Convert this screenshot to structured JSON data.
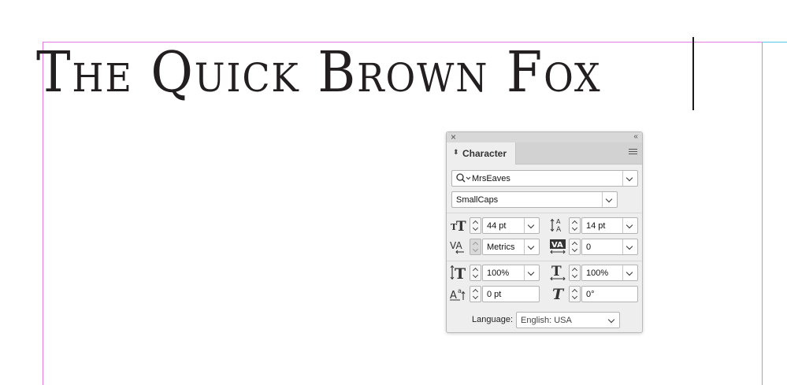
{
  "canvas": {
    "headline": "The Quick Brown Fox",
    "guide_color": "#e27ce0"
  },
  "panel": {
    "title": "Character",
    "font_family": "MrsEaves",
    "font_style": "SmallCaps",
    "font_size": "44 pt",
    "leading": "14 pt",
    "kerning": "Metrics",
    "tracking": "0",
    "vertical_scale": "100%",
    "horizontal_scale": "100%",
    "baseline_shift": "0 pt",
    "skew": "0°",
    "language_label": "Language:",
    "language": "English: USA"
  }
}
